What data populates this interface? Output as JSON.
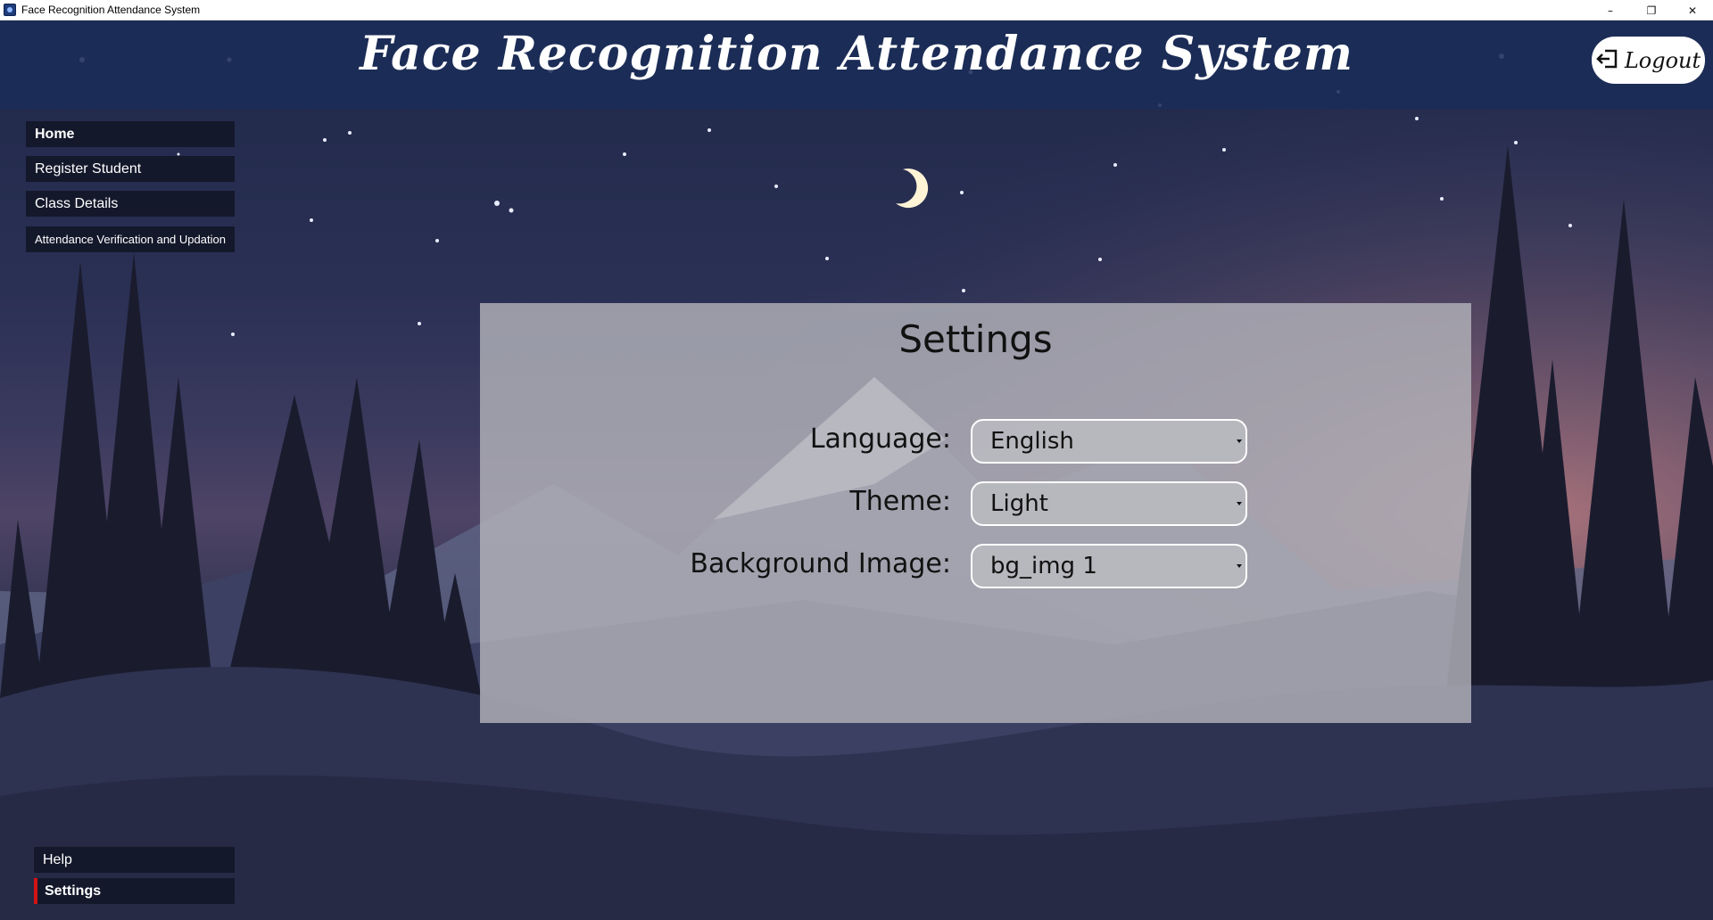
{
  "window": {
    "title": "Face Recognition Attendance System",
    "controls": {
      "minimize": "–",
      "restore": "❐",
      "close": "✕"
    }
  },
  "header": {
    "app_title": "Face Recognition Attendance System",
    "logout_label": "Logout",
    "logout_icon": "logout-icon"
  },
  "sidebar": {
    "items": [
      {
        "label": "Home"
      },
      {
        "label": "Register Student"
      },
      {
        "label": "Class Details"
      },
      {
        "label": "Attendance Verification and Updation"
      }
    ],
    "bottom_items": [
      {
        "label": "Help"
      },
      {
        "label": "Settings"
      }
    ]
  },
  "settings": {
    "title": "Settings",
    "language": {
      "label": "Language:",
      "value": "English"
    },
    "theme": {
      "label": "Theme:",
      "value": "Light"
    },
    "background": {
      "label": "Background Image:",
      "value": "bg_img 1"
    }
  },
  "colors": {
    "header_band": "#1a2c58",
    "sidebar_item": "#14182b",
    "active_indicator": "#d21414",
    "panel": "#b2b2ba"
  }
}
